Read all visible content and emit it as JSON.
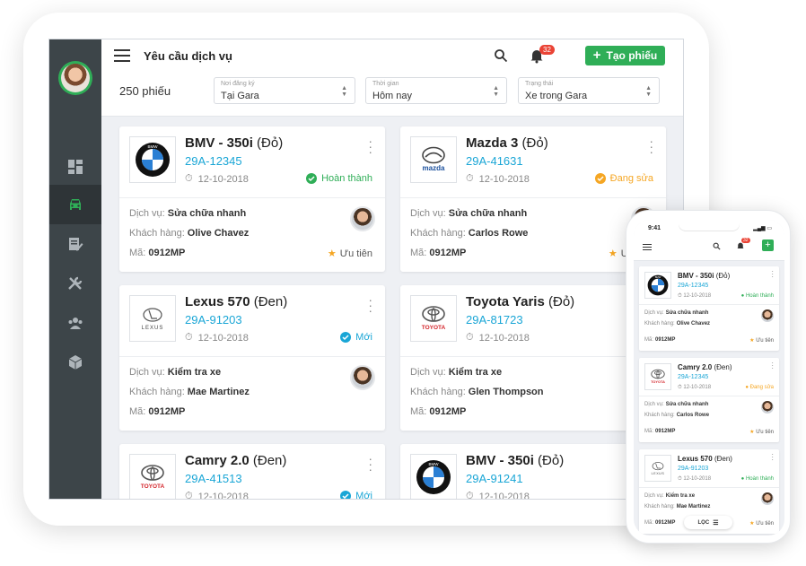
{
  "app": {
    "title": "Yêu cầu dịch vụ",
    "create_label": "Tạo phiếu",
    "notif_count": "32",
    "total": "250 phiếu"
  },
  "filters": [
    {
      "label": "Nơi đăng ký",
      "value": "Tại Gara"
    },
    {
      "label": "Thời gian",
      "value": "Hôm nay"
    },
    {
      "label": "Trạng thái",
      "value": "Xe trong Gara"
    }
  ],
  "field_labels": {
    "service": "Dịch vụ:",
    "customer": "Khách hàng:",
    "code": "Mã:"
  },
  "cards": [
    {
      "brand": "bmw",
      "model": "BMV - 350i",
      "color": "(Đỏ)",
      "plate": "29A-12345",
      "date": "12-10-2018",
      "status": "Hoàn thành",
      "status_color": "#2fae57",
      "service": "Sửa chữa nhanh",
      "customer": "Olive Chavez",
      "code": "0912MP",
      "priority": "Ưu tiên"
    },
    {
      "brand": "mazda",
      "model": "Mazda 3",
      "color": "(Đỏ)",
      "plate": "29A-41631",
      "date": "12-10-2018",
      "status": "Đang sửa",
      "status_color": "#f5a623",
      "service": "Sửa chữa nhanh",
      "customer": "Carlos Rowe",
      "code": "0912MP",
      "priority": "Ưu tiên"
    },
    {
      "brand": "lexus",
      "model": "Lexus 570",
      "color": "(Đen)",
      "plate": "29A-91203",
      "date": "12-10-2018",
      "status": "Mới",
      "status_color": "#1aa6d6",
      "service": "Kiểm tra xe",
      "customer": "Mae Martinez",
      "code": "0912MP"
    },
    {
      "brand": "toyota",
      "model": "Toyota Yaris",
      "color": "(Đỏ)",
      "plate": "29A-81723",
      "date": "12-10-2018",
      "status": "",
      "status_color": "#1aa6d6",
      "service": "Kiểm tra xe",
      "customer": "Glen Thompson",
      "code": "0912MP"
    },
    {
      "brand": "toyota",
      "model": "Camry 2.0",
      "color": "(Đen)",
      "plate": "29A-41513",
      "date": "12-10-2018",
      "status": "Mới",
      "status_color": "#1aa6d6"
    },
    {
      "brand": "bmw",
      "model": "BMV - 350i",
      "color": "(Đỏ)",
      "plate": "29A-91241",
      "date": "12-10-2018",
      "status": "",
      "status_color": "#1aa6d6"
    }
  ],
  "phone": {
    "time": "9:41",
    "notif_count": "32",
    "filter_label": "LỌC",
    "cards": [
      {
        "brand": "bmw",
        "model": "BMV - 350i",
        "color": "(Đỏ)",
        "plate": "29A-12345",
        "date": "12-10-2018",
        "status": "Hoàn thành",
        "status_color": "#2fae57",
        "service": "Sửa chữa nhanh",
        "customer": "Olive Chavez",
        "code": "0912MP",
        "priority": "Ưu tiên"
      },
      {
        "brand": "toyota",
        "model": "Camry 2.0",
        "color": "(Đen)",
        "plate": "29A-12345",
        "date": "12-10-2018",
        "status": "Đang sửa",
        "status_color": "#f5a623",
        "service": "Sửa chữa nhanh",
        "customer": "Carlos Rowe",
        "code": "0912MP",
        "priority": "Ưu tiên"
      },
      {
        "brand": "lexus",
        "model": "Lexus 570",
        "color": "(Đen)",
        "plate": "29A-91203",
        "date": "12-10-2018",
        "status": "Hoàn thành",
        "status_color": "#2fae57",
        "service": "Kiểm tra xe",
        "customer": "Mae Martinez",
        "code": "0912MP",
        "priority": "Ưu tiên"
      }
    ]
  },
  "logo_text": {
    "bmw": "BMW",
    "mazda": "mazda",
    "lexus": "LEXUS",
    "toyota": "TOYOTA"
  },
  "colors": {
    "accent": "#2fae57",
    "link": "#1aa6d6",
    "sidebar": "#3d4549",
    "warning": "#f5a623"
  }
}
